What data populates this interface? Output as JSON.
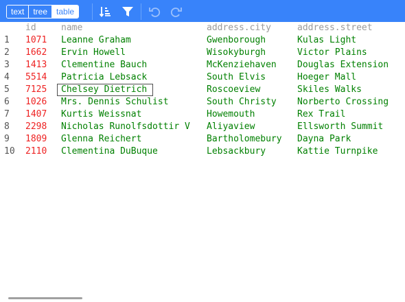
{
  "menu": {
    "modes": [
      "text",
      "tree",
      "table"
    ],
    "active_mode": "table",
    "tools": [
      {
        "name": "sort",
        "icon": "sort-icon",
        "enabled": true
      },
      {
        "name": "filter",
        "icon": "filter-icon",
        "enabled": true
      },
      {
        "name": "undo",
        "icon": "undo-icon",
        "enabled": false
      },
      {
        "name": "redo",
        "icon": "redo-icon",
        "enabled": false
      }
    ]
  },
  "colors": {
    "accent": "#3883fa",
    "number": "#ee2222",
    "string": "#008000",
    "header": "#9a9a9a"
  },
  "table": {
    "columns": [
      "id",
      "name",
      "address.city",
      "address.street"
    ],
    "selected_row": 5,
    "rows": [
      {
        "index": "1",
        "id": "1071",
        "name": "Leanne Graham",
        "city": "Gwenborough",
        "street": "Kulas Light"
      },
      {
        "index": "2",
        "id": "1662",
        "name": "Ervin Howell",
        "city": "Wisokyburgh",
        "street": "Victor Plains"
      },
      {
        "index": "3",
        "id": "1413",
        "name": "Clementine Bauch",
        "city": "McKenziehaven",
        "street": "Douglas Extension"
      },
      {
        "index": "4",
        "id": "5514",
        "name": "Patricia Lebsack",
        "city": "South Elvis",
        "street": "Hoeger Mall"
      },
      {
        "index": "5",
        "id": "7125",
        "name": "Chelsey Dietrich",
        "city": "Roscoeview",
        "street": "Skiles Walks"
      },
      {
        "index": "6",
        "id": "1026",
        "name": "Mrs. Dennis Schulist",
        "city": "South Christy",
        "street": "Norberto Crossing"
      },
      {
        "index": "7",
        "id": "1407",
        "name": "Kurtis Weissnat",
        "city": "Howemouth",
        "street": "Rex Trail"
      },
      {
        "index": "8",
        "id": "2298",
        "name": "Nicholas Runolfsdottir V",
        "city": "Aliyaview",
        "street": "Ellsworth Summit"
      },
      {
        "index": "9",
        "id": "1809",
        "name": "Glenna Reichert",
        "city": "Bartholomebury",
        "street": "Dayna Park"
      },
      {
        "index": "10",
        "id": "2110",
        "name": "Clementina DuBuque",
        "city": "Lebsackbury",
        "street": "Kattie Turnpike"
      }
    ]
  }
}
